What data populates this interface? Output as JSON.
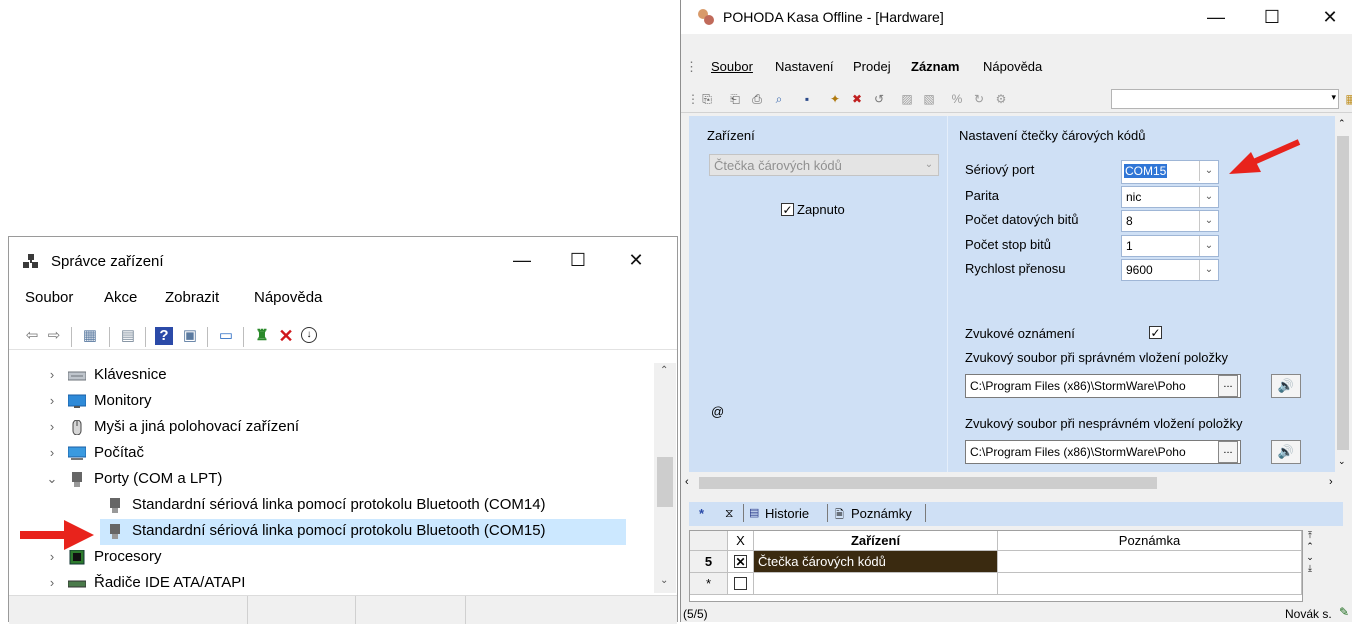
{
  "device_manager": {
    "title": "Správce zařízení",
    "menu": [
      "Soubor",
      "Akce",
      "Zobrazit",
      "Nápověda"
    ],
    "tree": [
      {
        "label": "Klávesnice",
        "icon": "keyboard-icon",
        "expanded": false
      },
      {
        "label": "Monitory",
        "icon": "monitor-icon",
        "expanded": false
      },
      {
        "label": "Myši a jiná polohovací zařízení",
        "icon": "mouse-icon",
        "expanded": false
      },
      {
        "label": "Počítač",
        "icon": "computer-icon",
        "expanded": false
      },
      {
        "label": "Porty (COM a LPT)",
        "icon": "port-icon",
        "expanded": true
      },
      {
        "label": "Standardní sériová linka pomocí protokolu Bluetooth (COM14)",
        "icon": "port-icon",
        "child": true
      },
      {
        "label": "Standardní sériová linka pomocí protokolu Bluetooth (COM15)",
        "icon": "port-icon",
        "child": true,
        "selected": true
      },
      {
        "label": "Procesory",
        "icon": "processor-icon",
        "expanded": false
      },
      {
        "label": "Řadiče IDE ATA/ATAPI",
        "icon": "ide-icon",
        "expanded": false
      }
    ]
  },
  "pohoda": {
    "title": "POHODA Kasa Offline - [Hardware]",
    "menu": [
      "Soubor",
      "Nastavení",
      "Prodej",
      "Záznam",
      "Nápověda"
    ],
    "device_section": {
      "header": "Zařízení",
      "selected_device": "Čtečka čárových kódů",
      "enabled_label": "Zapnuto",
      "at_sign": "@"
    },
    "scanner_section": {
      "header": "Nastavení čtečky čárových kódů",
      "fields": [
        {
          "label": "Sériový port",
          "value": "COM15"
        },
        {
          "label": "Parita",
          "value": "nic"
        },
        {
          "label": "Počet datových bitů",
          "value": "8"
        },
        {
          "label": "Počet stop bitů",
          "value": "1"
        },
        {
          "label": "Rychlost přenosu",
          "value": "9600"
        }
      ],
      "sound_notification_label": "Zvukové oznámení",
      "sound_ok_label": "Zvukový soubor při správném vložení položky",
      "sound_ok_path": "C:\\Program Files (x86)\\StormWare\\Poho",
      "sound_bad_label": "Zvukový soubor při nesprávném vložení položky",
      "sound_bad_path": "C:\\Program Files (x86)\\StormWare\\Poho",
      "dots": "..."
    },
    "tabs": {
      "star": "*",
      "history": "Historie",
      "notes": "Poznámky"
    },
    "grid": {
      "columns": [
        "X",
        "Zařízení",
        "Poznámka"
      ],
      "rows": [
        {
          "num": "5",
          "device": "Čtečka čárových kódů",
          "note": ""
        },
        {
          "num": "*",
          "device": "",
          "note": ""
        }
      ]
    },
    "status_left": "(5/5)",
    "status_right": "Novák s."
  },
  "colors": {
    "arrow": "#e8231c",
    "form_bg": "#cfe0f5",
    "selection": "#cce8ff",
    "grid_selected": "#3a2a10"
  }
}
